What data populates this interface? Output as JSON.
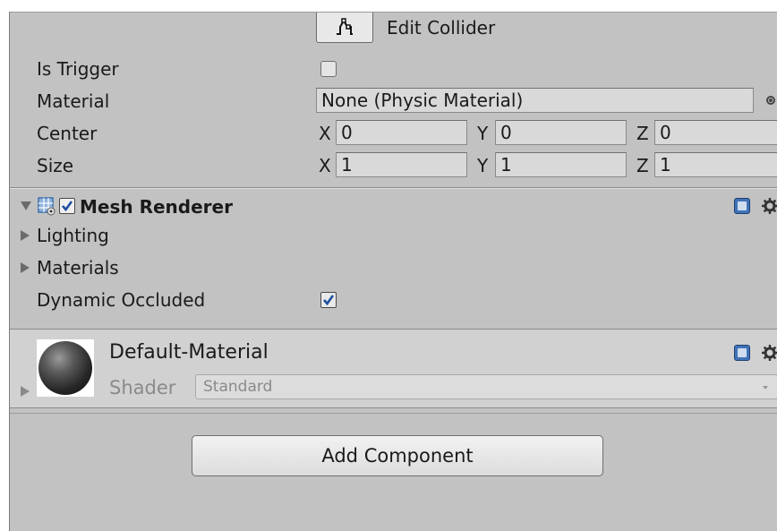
{
  "collider": {
    "edit_label": "Edit Collider",
    "is_trigger_label": "Is Trigger",
    "material_label": "Material",
    "material_value": "None (Physic Material)",
    "center_label": "Center",
    "center": {
      "x_label": "X",
      "x": "0",
      "y_label": "Y",
      "y": "0",
      "z_label": "Z",
      "z": "0"
    },
    "size_label": "Size",
    "size": {
      "x_label": "X",
      "x": "1",
      "y_label": "Y",
      "y": "1",
      "z_label": "Z",
      "z": "1"
    }
  },
  "mesh_renderer": {
    "title": "Mesh Renderer",
    "lighting_label": "Lighting",
    "materials_label": "Materials",
    "dynamic_occluded_label": "Dynamic Occluded",
    "dynamic_occluded": true
  },
  "material_asset": {
    "name": "Default-Material",
    "shader_label": "Shader",
    "shader_value": "Standard"
  },
  "add_component_label": "Add Component",
  "colors": {
    "panel_bg": "#c2c2c2",
    "material_header_bg": "#d1d1d1",
    "checkbox_accent": "#1f4fa0",
    "help_blue": "#3f73b8"
  },
  "icons": {
    "edit_collider": "edit-collider-icon",
    "mesh_renderer": "mesh-renderer-icon",
    "help": "help-icon",
    "gear": "gear-icon",
    "object_picker": "object-picker-icon",
    "material_preview": "sphere-preview-icon"
  }
}
